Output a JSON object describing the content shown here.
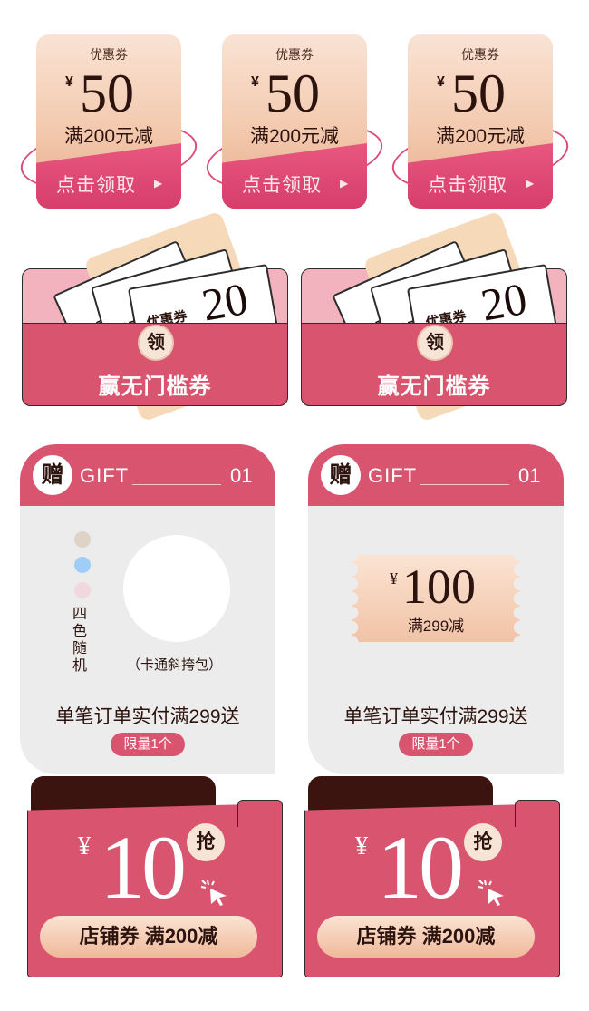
{
  "top_coupons": [
    {
      "label": "优惠券",
      "currency": "¥",
      "amount": "50",
      "condition": "满200元减",
      "cta": "点击领取"
    },
    {
      "label": "优惠券",
      "currency": "¥",
      "amount": "50",
      "condition": "满200元减",
      "cta": "点击领取"
    },
    {
      "label": "优惠券",
      "currency": "¥",
      "amount": "50",
      "condition": "满200元减",
      "cta": "点击领取"
    }
  ],
  "envelopes": [
    {
      "ticket_label": "优惠券",
      "ticket_amount": "20",
      "badge": "领",
      "title": "赢无门槛券"
    },
    {
      "ticket_label": "优惠券",
      "ticket_amount": "20",
      "badge": "领",
      "title": "赢无门槛券"
    }
  ],
  "gifts": [
    {
      "badge": "赠",
      "word": "GIFT",
      "number": "01",
      "colors_label": "四色随机",
      "item_label": "（卡通斜挎包）",
      "swatches": [
        "#ddd3c7",
        "#9fcdf6",
        "#f1d8de"
      ],
      "title": "单笔订单实付满299送",
      "limit": "限量1个"
    },
    {
      "badge": "赠",
      "word": "GIFT",
      "number": "01",
      "coupon_currency": "¥",
      "coupon_amount": "100",
      "coupon_condition": "满299减",
      "title": "单笔订单实付满299送",
      "limit": "限量1个"
    }
  ],
  "shop_coupons": [
    {
      "currency": "¥",
      "amount": "10",
      "grab": "抢",
      "label": "店铺券 满200减"
    },
    {
      "currency": "¥",
      "amount": "10",
      "grab": "抢",
      "label": "店铺券 满200减"
    }
  ],
  "colors": {
    "accent": "#d9546f",
    "dark": "#3b1410",
    "gold": "#f1c3a6"
  }
}
